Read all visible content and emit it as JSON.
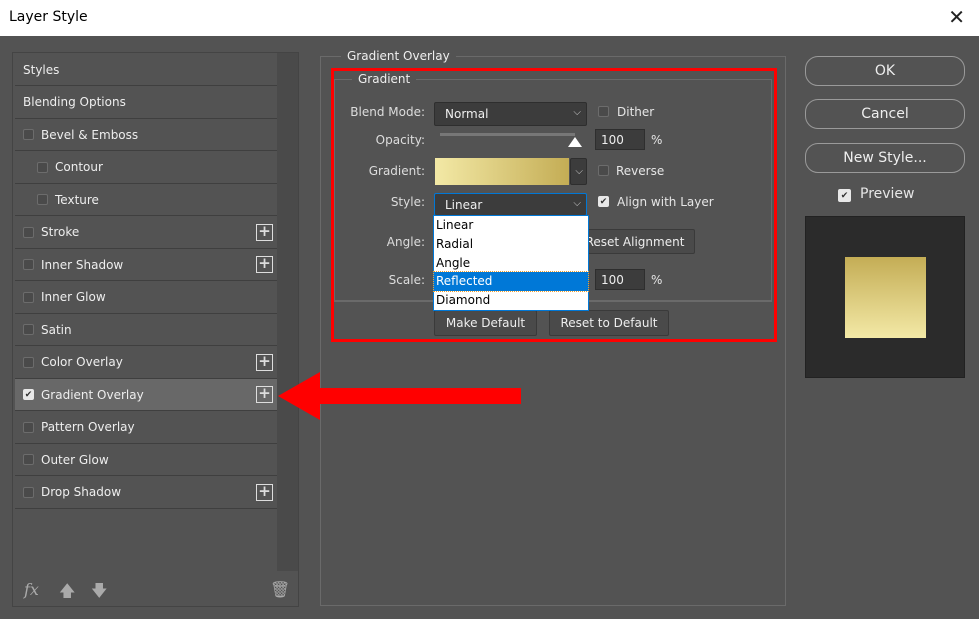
{
  "window": {
    "title": "Layer Style",
    "close": "✕"
  },
  "sidebar": {
    "items": [
      {
        "label": "Styles",
        "checkbox": false,
        "checked": false,
        "plus": false,
        "indent": 0
      },
      {
        "label": "Blending Options",
        "checkbox": false,
        "checked": false,
        "plus": false,
        "indent": 0
      },
      {
        "label": "Bevel & Emboss",
        "checkbox": true,
        "checked": false,
        "plus": false,
        "indent": 0
      },
      {
        "label": "Contour",
        "checkbox": true,
        "checked": false,
        "plus": false,
        "indent": 1
      },
      {
        "label": "Texture",
        "checkbox": true,
        "checked": false,
        "plus": false,
        "indent": 1
      },
      {
        "label": "Stroke",
        "checkbox": true,
        "checked": false,
        "plus": true,
        "indent": 0
      },
      {
        "label": "Inner Shadow",
        "checkbox": true,
        "checked": false,
        "plus": true,
        "indent": 0
      },
      {
        "label": "Inner Glow",
        "checkbox": true,
        "checked": false,
        "plus": false,
        "indent": 0
      },
      {
        "label": "Satin",
        "checkbox": true,
        "checked": false,
        "plus": false,
        "indent": 0
      },
      {
        "label": "Color Overlay",
        "checkbox": true,
        "checked": false,
        "plus": true,
        "indent": 0
      },
      {
        "label": "Gradient Overlay",
        "checkbox": true,
        "checked": true,
        "plus": true,
        "indent": 0,
        "selected": true
      },
      {
        "label": "Pattern Overlay",
        "checkbox": true,
        "checked": false,
        "plus": false,
        "indent": 0
      },
      {
        "label": "Outer Glow",
        "checkbox": true,
        "checked": false,
        "plus": false,
        "indent": 0
      },
      {
        "label": "Drop Shadow",
        "checkbox": true,
        "checked": false,
        "plus": true,
        "indent": 0
      }
    ],
    "footer": {
      "fx": "fx",
      "up": "🡅",
      "down": "🡇",
      "trash": "🗑"
    }
  },
  "main": {
    "group_title": "Gradient Overlay",
    "sub_title": "Gradient",
    "blend_mode_label": "Blend Mode:",
    "blend_mode": "Normal",
    "dither_label": "Dither",
    "dither": false,
    "opacity_label": "Opacity:",
    "opacity": "100",
    "opacity_unit": "%",
    "gradient_label": "Gradient:",
    "gradient_colors": [
      "#f3e9a6",
      "#c4ad55"
    ],
    "reverse_label": "Reverse",
    "reverse": false,
    "style_label": "Style:",
    "style": "Linear",
    "align_label": "Align with Layer",
    "align": true,
    "angle_label": "Angle:",
    "reset_alignment": "Reset Alignment",
    "scale_label": "Scale:",
    "scale": "100",
    "scale_unit": "%",
    "style_options": [
      "Linear",
      "Radial",
      "Angle",
      "Reflected",
      "Diamond"
    ],
    "highlighted_option": "Reflected",
    "make_default": "Make Default",
    "reset_default": "Reset to Default"
  },
  "right": {
    "ok": "OK",
    "cancel": "Cancel",
    "new_style": "New Style...",
    "preview_label": "Preview",
    "preview": true
  },
  "annotation": {
    "color": "#ff0000"
  }
}
